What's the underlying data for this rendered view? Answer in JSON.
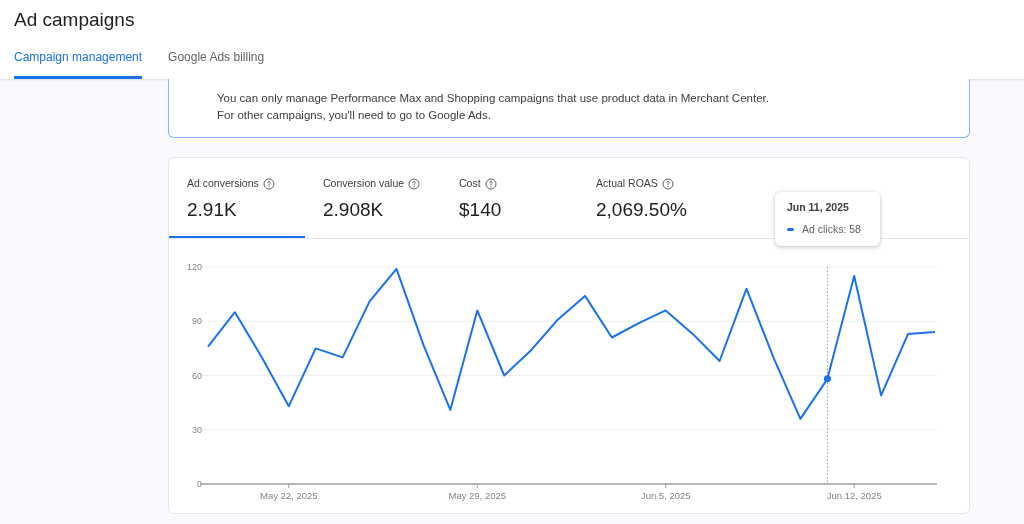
{
  "page": {
    "title": "Ad campaigns"
  },
  "tabs": [
    {
      "label": "Campaign management",
      "selected": true
    },
    {
      "label": "Google Ads billing",
      "selected": false
    }
  ],
  "banner": {
    "text": "You can only manage Performance Max and Shopping campaigns that use product data in Merchant Center. For other campaigns, you'll need to go to Google Ads."
  },
  "metrics": [
    {
      "label": "Ad conversions",
      "value": "2.91K",
      "selected": true
    },
    {
      "label": "Conversion value",
      "value": "2.908K",
      "selected": false
    },
    {
      "label": "Cost",
      "value": "$140",
      "selected": false
    },
    {
      "label": "Actual ROAS",
      "value": "2,069.50%",
      "selected": false
    }
  ],
  "tooltip": {
    "date": "Jun 11, 2025",
    "text": "Ad clicks: 58",
    "level": 0.852
  },
  "chart_data": {
    "type": "line",
    "categories": [
      null,
      null,
      null,
      "May 22, 2025",
      null,
      null,
      null,
      null,
      null,
      null,
      "May 29, 2025",
      null,
      null,
      null,
      null,
      null,
      null,
      "Jun 5, 2025",
      null,
      null,
      null,
      null,
      null,
      null,
      "Jun 12, 2025",
      null,
      null,
      null
    ],
    "series": [
      {
        "color": "#1a73e8",
        "values": [
          76,
          95,
          70,
          43,
          75,
          70,
          101,
          119,
          77,
          41,
          96,
          60,
          74,
          91,
          104,
          81,
          89,
          96,
          83,
          68,
          108,
          70,
          36,
          58,
          115,
          49,
          83,
          84
        ]
      }
    ],
    "ylim": [
      0,
      120
    ],
    "yticks": [
      0,
      30,
      60,
      90,
      120
    ],
    "grid": true
  }
}
